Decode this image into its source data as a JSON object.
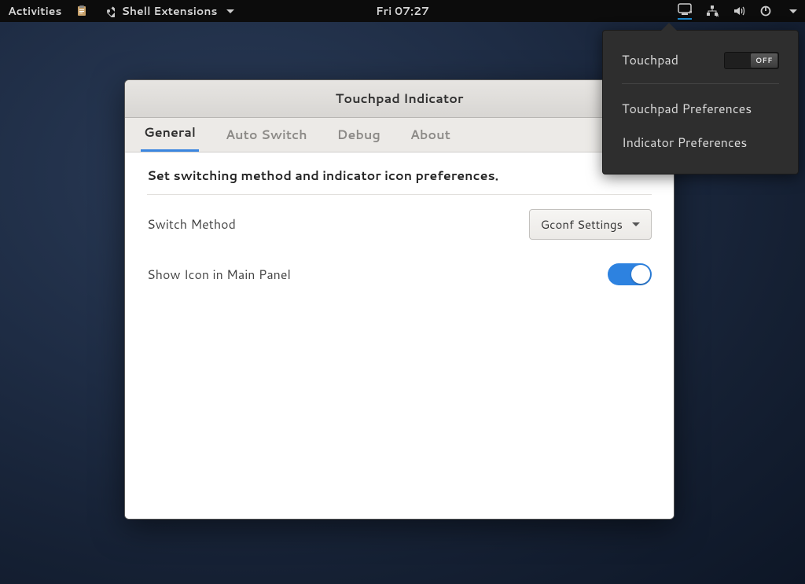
{
  "topbar": {
    "activities": "Activities",
    "app_name": "Shell Extensions",
    "clock": "Fri 07:27"
  },
  "popover": {
    "title": "Touchpad",
    "toggle_state": "OFF",
    "items": [
      "Touchpad Preferences",
      "Indicator Preferences"
    ]
  },
  "window": {
    "title": "Touchpad Indicator",
    "tabs": [
      "General",
      "Auto Switch",
      "Debug",
      "About"
    ],
    "active_tab": 0,
    "general": {
      "description": "Set switching method and indicator icon preferences.",
      "switch_method_label": "Switch Method",
      "switch_method_value": "Gconf Settings",
      "show_icon_label": "Show Icon in Main Panel",
      "show_icon_on": true
    }
  }
}
